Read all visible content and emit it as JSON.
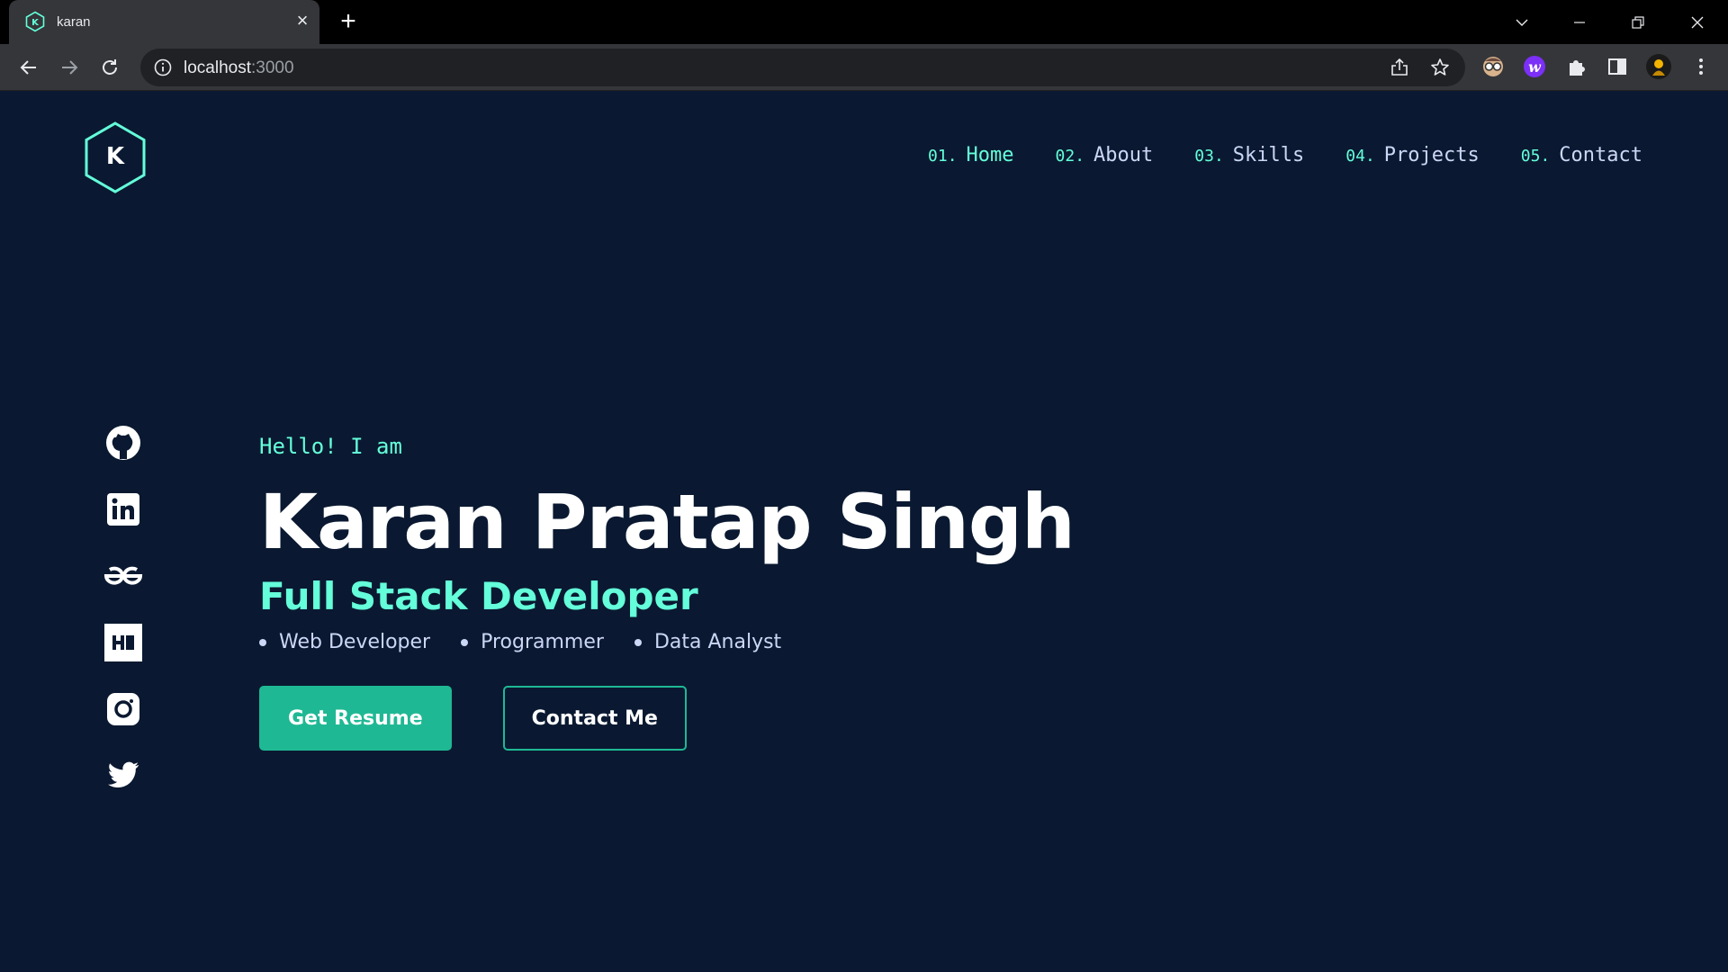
{
  "browser": {
    "tab": {
      "title": "karan"
    },
    "address": {
      "host": "localhost",
      "port": ":3000"
    }
  },
  "site": {
    "logo_letter": "K",
    "nav": [
      {
        "num": "01.",
        "label": "Home"
      },
      {
        "num": "02.",
        "label": "About"
      },
      {
        "num": "03.",
        "label": "Skills"
      },
      {
        "num": "04.",
        "label": "Projects"
      },
      {
        "num": "05.",
        "label": "Contact"
      }
    ],
    "socials": [
      "github-icon",
      "linkedin-icon",
      "geeksforgeeks-icon",
      "hashnode-icon",
      "instagram-icon",
      "twitter-icon"
    ],
    "hero": {
      "greeting": "Hello! I am",
      "name": "Karan Pratap Singh",
      "role": "Full Stack Developer",
      "skills": [
        "Web Developer",
        "Programmer",
        "Data Analyst"
      ],
      "primary_button": "Get Resume",
      "secondary_button": "Contact Me"
    }
  },
  "colors": {
    "background": "#0a1931",
    "accent": "#64ffda",
    "button": "#1fb894",
    "text": "#ccd6f6"
  }
}
